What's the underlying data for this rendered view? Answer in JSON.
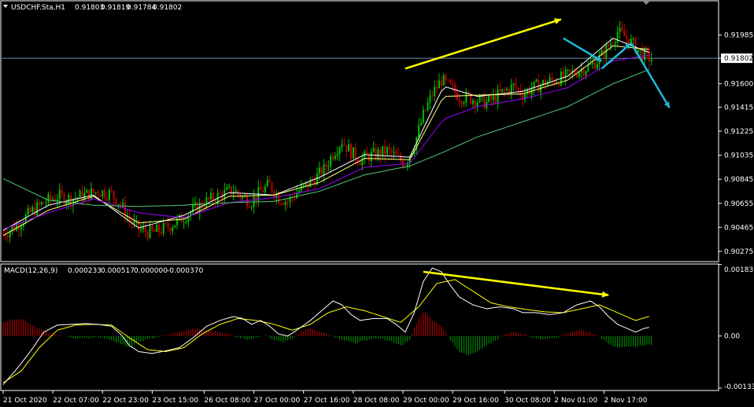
{
  "header": {
    "symbol_label": "USDCHF.Sta,H1",
    "ohlc": [
      "0.91803",
      "0.91819",
      "0.91784",
      "0.91802"
    ]
  },
  "macd_header": {
    "label": "MACD(12,26,9)",
    "values": [
      "0.000233",
      "0.000517",
      "0.000000",
      "-0.000370"
    ]
  },
  "colors": {
    "background": "#000000",
    "frame": "#ffffff",
    "bull_candle": "#00c000",
    "bear_candle": "#c00000",
    "fast_ma": "#ffffff",
    "mid_ma": "#ffff80",
    "slow_ma": "#a000ff",
    "long_ma": "#50c878",
    "macd_line": "#ffffff",
    "signal_line": "#ffff00",
    "hist_pos": "#c00000",
    "hist_neg": "#00a000",
    "annotation_arrow": "#ffff00",
    "forecast_arrow": "#1fb8d8",
    "current_price_line": "#6a8aa8"
  },
  "chart_data": [
    {
      "type": "candlestick",
      "pane": "price",
      "title": "USDCHF.Sta,H1",
      "current_price": "0.91802",
      "ylim": [
        0.902,
        0.9225
      ],
      "y_ticks": [
        "0.91985",
        "0.91802",
        "0.91600",
        "0.91415",
        "0.91225",
        "0.91035",
        "0.90845",
        "0.90655",
        "0.90465",
        "0.90275"
      ],
      "x_ticks": [
        "21 Oct 2020",
        "22 Oct 07:00",
        "22 Oct 23:00",
        "23 Oct 15:00",
        "26 Oct 08:00",
        "27 Oct 00:00",
        "27 Oct 16:00",
        "28 Oct 08:00",
        "29 Oct 00:00",
        "29 Oct 16:00",
        "30 Oct 08:00",
        "2 Nov 01:00",
        "2 Nov 17:00"
      ],
      "close_path": [
        [
          0,
          0.9041
        ],
        [
          6,
          0.9048
        ],
        [
          12,
          0.9058
        ],
        [
          18,
          0.9066
        ],
        [
          24,
          0.9071
        ],
        [
          30,
          0.9069
        ],
        [
          36,
          0.9072
        ],
        [
          42,
          0.9075
        ],
        [
          48,
          0.9073
        ],
        [
          52,
          0.9065
        ],
        [
          56,
          0.9052
        ],
        [
          60,
          0.9045
        ],
        [
          66,
          0.9042
        ],
        [
          72,
          0.9046
        ],
        [
          78,
          0.9052
        ],
        [
          84,
          0.906
        ],
        [
          90,
          0.9067
        ],
        [
          96,
          0.9072
        ],
        [
          102,
          0.9076
        ],
        [
          106,
          0.907
        ],
        [
          110,
          0.9067
        ],
        [
          114,
          0.9075
        ],
        [
          118,
          0.908
        ],
        [
          122,
          0.907
        ],
        [
          126,
          0.9067
        ],
        [
          130,
          0.9074
        ],
        [
          136,
          0.9082
        ],
        [
          142,
          0.9092
        ],
        [
          146,
          0.9105
        ],
        [
          150,
          0.9115
        ],
        [
          154,
          0.9106
        ],
        [
          158,
          0.91
        ],
        [
          164,
          0.9104
        ],
        [
          170,
          0.9107
        ],
        [
          174,
          0.9102
        ],
        [
          178,
          0.9097
        ],
        [
          182,
          0.9112
        ],
        [
          186,
          0.9135
        ],
        [
          190,
          0.9152
        ],
        [
          194,
          0.9163
        ],
        [
          198,
          0.9157
        ],
        [
          202,
          0.915
        ],
        [
          208,
          0.9148
        ],
        [
          214,
          0.9145
        ],
        [
          220,
          0.9152
        ],
        [
          226,
          0.9158
        ],
        [
          230,
          0.9152
        ],
        [
          236,
          0.9158
        ],
        [
          242,
          0.9162
        ],
        [
          248,
          0.9165
        ],
        [
          254,
          0.917
        ],
        [
          260,
          0.9174
        ],
        [
          264,
          0.918
        ],
        [
          268,
          0.919
        ],
        [
          272,
          0.9201
        ],
        [
          276,
          0.9196
        ],
        [
          280,
          0.9189
        ],
        [
          284,
          0.9182
        ],
        [
          287,
          0.918
        ]
      ],
      "moving_averages": [
        {
          "color_key": "fast_ma",
          "points": [
            [
              0,
              0.9044
            ],
            [
              20,
              0.9064
            ],
            [
              40,
              0.9072
            ],
            [
              60,
              0.9046
            ],
            [
              80,
              0.9056
            ],
            [
              100,
              0.9074
            ],
            [
              120,
              0.9072
            ],
            [
              140,
              0.9086
            ],
            [
              160,
              0.9104
            ],
            [
              180,
              0.9102
            ],
            [
              195,
              0.9158
            ],
            [
              210,
              0.915
            ],
            [
              230,
              0.9154
            ],
            [
              250,
              0.9166
            ],
            [
              270,
              0.9196
            ],
            [
              287,
              0.9184
            ]
          ]
        },
        {
          "color_key": "mid_ma",
          "points": [
            [
              0,
              0.904
            ],
            [
              20,
              0.906
            ],
            [
              40,
              0.9071
            ],
            [
              60,
              0.905
            ],
            [
              80,
              0.9053
            ],
            [
              100,
              0.9071
            ],
            [
              120,
              0.9072
            ],
            [
              140,
              0.9082
            ],
            [
              160,
              0.9101
            ],
            [
              180,
              0.91
            ],
            [
              195,
              0.915
            ],
            [
              210,
              0.9151
            ],
            [
              230,
              0.9152
            ],
            [
              250,
              0.9163
            ],
            [
              270,
              0.919
            ],
            [
              287,
              0.9187
            ]
          ]
        },
        {
          "color_key": "slow_ma",
          "points": [
            [
              0,
              0.9045
            ],
            [
              20,
              0.9058
            ],
            [
              40,
              0.9069
            ],
            [
              60,
              0.9058
            ],
            [
              80,
              0.9054
            ],
            [
              100,
              0.9066
            ],
            [
              120,
              0.907
            ],
            [
              140,
              0.9077
            ],
            [
              160,
              0.9094
            ],
            [
              180,
              0.9097
            ],
            [
              195,
              0.9132
            ],
            [
              210,
              0.9142
            ],
            [
              230,
              0.9148
            ],
            [
              250,
              0.9157
            ],
            [
              270,
              0.9178
            ],
            [
              287,
              0.9183
            ]
          ]
        },
        {
          "color_key": "long_ma",
          "points": [
            [
              0,
              0.9085
            ],
            [
              20,
              0.9068
            ],
            [
              40,
              0.9064
            ],
            [
              60,
              0.9063
            ],
            [
              80,
              0.9064
            ],
            [
              100,
              0.9066
            ],
            [
              120,
              0.9067
            ],
            [
              140,
              0.9075
            ],
            [
              160,
              0.9088
            ],
            [
              180,
              0.9095
            ],
            [
              195,
              0.9106
            ],
            [
              210,
              0.9118
            ],
            [
              230,
              0.913
            ],
            [
              250,
              0.9142
            ],
            [
              270,
              0.916
            ],
            [
              287,
              0.9172
            ]
          ]
        }
      ],
      "annotations": [
        {
          "kind": "trend_arrow",
          "color_key": "annotation_arrow",
          "from": [
            178,
            0.9172
          ],
          "to": [
            247,
            0.9211
          ]
        },
        {
          "kind": "forecast_arrow",
          "color_key": "forecast_arrow",
          "points": [
            [
              248,
              0.9196
            ],
            [
              265,
              0.9178
            ]
          ]
        },
        {
          "kind": "forecast_arrow",
          "color_key": "forecast_arrow",
          "points": [
            [
              265,
              0.9172
            ],
            [
              278,
              0.9192
            ]
          ]
        },
        {
          "kind": "forecast_arrow",
          "color_key": "forecast_arrow",
          "points": [
            [
              278,
              0.9192
            ],
            [
              295,
              0.9141
            ]
          ]
        }
      ]
    },
    {
      "type": "macd",
      "pane": "indicator",
      "title": "MACD(12,26,9)",
      "ylim": [
        -0.00138,
        0.00183
      ],
      "y_ticks": [
        "0.001837",
        "0.00",
        "-0.001338"
      ],
      "macd_path": [
        [
          0,
          -0.00125
        ],
        [
          6,
          -0.00085
        ],
        [
          12,
          -0.0004
        ],
        [
          18,
          0.0001
        ],
        [
          24,
          0.00028
        ],
        [
          30,
          0.0003
        ],
        [
          36,
          0.00032
        ],
        [
          42,
          0.0003
        ],
        [
          48,
          0.00025
        ],
        [
          52,
          5e-05
        ],
        [
          56,
          -0.00025
        ],
        [
          60,
          -0.0004
        ],
        [
          66,
          -0.00045
        ],
        [
          72,
          -0.00038
        ],
        [
          78,
          -0.0003
        ],
        [
          84,
          -5e-05
        ],
        [
          90,
          0.00025
        ],
        [
          96,
          0.0004
        ],
        [
          102,
          0.0005
        ],
        [
          106,
          0.00045
        ],
        [
          110,
          0.0003
        ],
        [
          114,
          0.0004
        ],
        [
          118,
          0.00025
        ],
        [
          122,
          5e-05
        ],
        [
          126,
          0.0
        ],
        [
          130,
          0.00015
        ],
        [
          136,
          0.0004
        ],
        [
          142,
          0.0007
        ],
        [
          146,
          0.0009
        ],
        [
          150,
          0.0008
        ],
        [
          154,
          0.00055
        ],
        [
          158,
          0.0004
        ],
        [
          164,
          0.00045
        ],
        [
          170,
          0.00045
        ],
        [
          174,
          0.0003
        ],
        [
          178,
          0.0001
        ],
        [
          182,
          0.0006
        ],
        [
          186,
          0.0014
        ],
        [
          190,
          0.00175
        ],
        [
          194,
          0.00165
        ],
        [
          198,
          0.0013
        ],
        [
          202,
          0.001
        ],
        [
          208,
          0.0008
        ],
        [
          214,
          0.0007
        ],
        [
          220,
          0.00075
        ],
        [
          226,
          0.0007
        ],
        [
          230,
          0.0006
        ],
        [
          236,
          0.0006
        ],
        [
          242,
          0.00055
        ],
        [
          248,
          0.0006
        ],
        [
          254,
          0.0008
        ],
        [
          260,
          0.0009
        ],
        [
          264,
          0.00075
        ],
        [
          268,
          0.0005
        ],
        [
          272,
          0.0003
        ],
        [
          276,
          0.0002
        ],
        [
          280,
          0.0001
        ],
        [
          284,
          0.0002
        ],
        [
          287,
          0.00023
        ]
      ],
      "signal_path": [
        [
          0,
          -0.0012
        ],
        [
          8,
          -0.0009
        ],
        [
          16,
          -0.0003
        ],
        [
          24,
          0.00015
        ],
        [
          32,
          0.00028
        ],
        [
          40,
          0.0003
        ],
        [
          48,
          0.00028
        ],
        [
          56,
          -5e-05
        ],
        [
          64,
          -0.00035
        ],
        [
          72,
          -0.0004
        ],
        [
          80,
          -0.0003
        ],
        [
          88,
          5e-05
        ],
        [
          96,
          0.0003
        ],
        [
          104,
          0.00045
        ],
        [
          112,
          0.0004
        ],
        [
          120,
          0.0003
        ],
        [
          128,
          0.00015
        ],
        [
          136,
          0.0003
        ],
        [
          144,
          0.0006
        ],
        [
          152,
          0.00075
        ],
        [
          160,
          0.00065
        ],
        [
          168,
          0.0005
        ],
        [
          176,
          0.00035
        ],
        [
          184,
          0.00075
        ],
        [
          192,
          0.00135
        ],
        [
          200,
          0.00145
        ],
        [
          208,
          0.00115
        ],
        [
          216,
          0.00085
        ],
        [
          224,
          0.00075
        ],
        [
          232,
          0.00068
        ],
        [
          240,
          0.00062
        ],
        [
          248,
          0.0006
        ],
        [
          256,
          0.0007
        ],
        [
          264,
          0.0008
        ],
        [
          272,
          0.0006
        ],
        [
          280,
          0.0004
        ],
        [
          287,
          0.00052
        ]
      ],
      "histogram": [
        [
          0,
          0.00035
        ],
        [
          4,
          0.00042
        ],
        [
          8,
          0.00045
        ],
        [
          12,
          0.0003
        ],
        [
          16,
          0.00018
        ],
        [
          20,
          8e-05
        ],
        [
          24,
          3e-05
        ],
        [
          30,
          -4e-05
        ],
        [
          36,
          -6e-05
        ],
        [
          42,
          -2e-05
        ],
        [
          48,
          -0.0001
        ],
        [
          52,
          -0.0002
        ],
        [
          56,
          -0.0003
        ],
        [
          60,
          -0.00015
        ],
        [
          66,
          -5e-05
        ],
        [
          72,
          2e-05
        ],
        [
          78,
          0.0001
        ],
        [
          84,
          0.00018
        ],
        [
          90,
          0.00015
        ],
        [
          96,
          0.0001
        ],
        [
          100,
          5e-05
        ],
        [
          104,
          -3e-05
        ],
        [
          108,
          -8e-05
        ],
        [
          112,
          -5e-05
        ],
        [
          116,
          4e-05
        ],
        [
          120,
          -0.0001
        ],
        [
          124,
          -0.00015
        ],
        [
          128,
          -8e-05
        ],
        [
          132,
          0.00012
        ],
        [
          136,
          0.0002
        ],
        [
          140,
          0.0001
        ],
        [
          144,
          5e-05
        ],
        [
          148,
          -5e-05
        ],
        [
          152,
          -0.00012
        ],
        [
          156,
          -0.00018
        ],
        [
          160,
          -0.00012
        ],
        [
          164,
          -5e-05
        ],
        [
          168,
          -8e-05
        ],
        [
          172,
          -0.00015
        ],
        [
          176,
          -0.00025
        ],
        [
          180,
          -0.0001
        ],
        [
          182,
          0.0002
        ],
        [
          184,
          0.00045
        ],
        [
          186,
          0.0006
        ],
        [
          188,
          0.00055
        ],
        [
          190,
          0.0004
        ],
        [
          194,
          0.00025
        ],
        [
          198,
          -0.0001
        ],
        [
          202,
          -0.0004
        ],
        [
          206,
          -0.0005
        ],
        [
          210,
          -0.0004
        ],
        [
          214,
          -0.00025
        ],
        [
          218,
          -0.0001
        ],
        [
          222,
          5e-05
        ],
        [
          226,
          0.0001
        ],
        [
          230,
          5e-05
        ],
        [
          234,
          -3e-05
        ],
        [
          238,
          -8e-05
        ],
        [
          242,
          -6e-05
        ],
        [
          246,
          -2e-05
        ],
        [
          250,
          8e-05
        ],
        [
          254,
          0.00015
        ],
        [
          258,
          0.00012
        ],
        [
          262,
          6e-05
        ],
        [
          266,
          -0.0001
        ],
        [
          270,
          -0.00025
        ],
        [
          274,
          -0.0003
        ],
        [
          278,
          -0.00028
        ],
        [
          282,
          -0.00025
        ],
        [
          286,
          -0.00022
        ]
      ],
      "annotations": [
        {
          "kind": "trend_arrow",
          "color_key": "annotation_arrow",
          "from": [
            186,
            0.00165
          ],
          "to": [
            268,
            0.00105
          ]
        }
      ]
    }
  ]
}
